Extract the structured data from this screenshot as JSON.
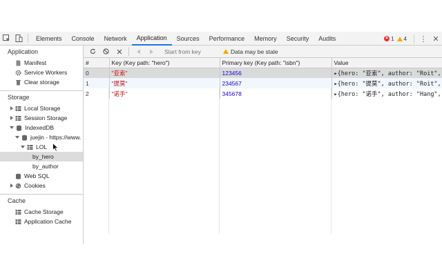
{
  "tabs": [
    "Elements",
    "Console",
    "Network",
    "Application",
    "Sources",
    "Performance",
    "Memory",
    "Security",
    "Audits"
  ],
  "active_tab": "Application",
  "status": {
    "errors": "1",
    "warnings": "4"
  },
  "sidebar": {
    "application_title": "Application",
    "application_items": [
      "Manifest",
      "Service Workers",
      "Clear storage"
    ],
    "storage_title": "Storage",
    "local_storage": "Local Storage",
    "session_storage": "Session Storage",
    "indexeddb": "IndexedDB",
    "database": "juejin - https://www.",
    "object_store": "LOL",
    "index_by_hero": "by_hero",
    "index_by_author": "by_author",
    "web_sql": "Web SQL",
    "cookies": "Cookies",
    "cache_title": "Cache",
    "cache_items": [
      "Cache Storage",
      "Application Cache"
    ]
  },
  "toolbar": {
    "start_from_key_placeholder": "Start from key",
    "stale_warning": "Data may be stale"
  },
  "table": {
    "headers": [
      "#",
      "Key (Key path: \"hero\")",
      "Primary key (Key path: \"isbn\")",
      "Value"
    ],
    "rows": [
      {
        "index": "0",
        "key": "\"亚索\"",
        "primary_key": "123456",
        "value": "▸{hero: \"亚索\", author: \"Roit\", "
      },
      {
        "index": "1",
        "key": "\"提莫\"",
        "primary_key": "234567",
        "value": "▸{hero: \"提莫\", author: \"Roit\", "
      },
      {
        "index": "2",
        "key": "\"诺手\"",
        "primary_key": "345678",
        "value": "▸{hero: \"诺手\", author: \"Hang\", "
      }
    ]
  },
  "colors": {
    "accent": "#1a73e8",
    "error": "#e33333",
    "warning": "#f2a900",
    "string": "#c41a16",
    "number": "#1c00cf"
  }
}
